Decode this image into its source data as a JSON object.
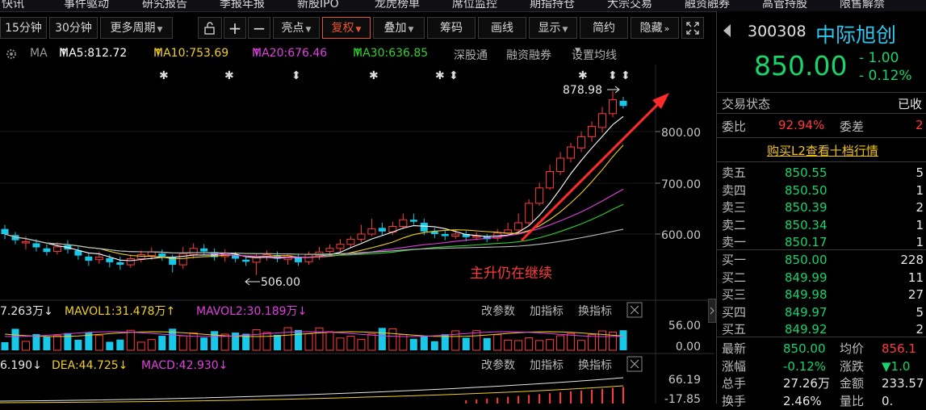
{
  "top_nav": [
    "快讯",
    "事件驱动",
    "研究报告",
    "季报年报",
    "新股IPO",
    "龙虎榜单",
    "席位监控",
    "期指持仓",
    "大宗交易",
    "融资融券",
    "高管持股",
    "限售解禁"
  ],
  "toolbar": {
    "buttons": [
      "15分钟",
      "30分钟",
      "更多周期",
      "",
      "+",
      "−",
      "亮点",
      "复权",
      "叠加",
      "筹码",
      "画线",
      "显示",
      "简约",
      "隐藏"
    ],
    "active": "复权"
  },
  "ma_bar": {
    "label": "MA",
    "ma5": "MA5:812.72",
    "ma10": "MA10:753.69",
    "ma20": "MA20:676.46",
    "ma30": "MA30:636.85",
    "links": [
      "深股通",
      "融资融券",
      "设置均线"
    ]
  },
  "price_axis": [
    "800.00",
    "700.00",
    "600.00"
  ],
  "annotations": {
    "high": "878.98",
    "low": "506.00",
    "comment": "主升仍在继续"
  },
  "volume_bar": {
    "vol": "7.263万",
    "mavol1": "MAVOL1:31.478万",
    "mavol2": "MAVOL2:30.189万",
    "links": [
      "改参数",
      "加指标",
      "换指标"
    ],
    "axis": [
      "56.00",
      "0.00"
    ]
  },
  "macd_bar": {
    "dif": "6.190",
    "dea": "DEA:44.725",
    "macd": "MACD:42.930",
    "links": [
      "改参数",
      "加指标",
      "换指标"
    ],
    "axis": [
      "66.19",
      "-17.85"
    ]
  },
  "quote": {
    "code": "300308",
    "name": "中际旭创",
    "price": "850.00",
    "change": "- 1.00",
    "change_pct": "- 0.12%",
    "status_label": "交易状态",
    "status_value": "已收",
    "weibi_label": "委比",
    "weibi_value": "92.94%",
    "weicha_label": "委差",
    "weicha_value": "2",
    "l2_link": "购买L2查看十档行情",
    "asks": [
      {
        "label": "卖五",
        "price": "850.55",
        "vol": "5"
      },
      {
        "label": "卖四",
        "price": "850.50",
        "vol": "1"
      },
      {
        "label": "卖三",
        "price": "850.39",
        "vol": "2"
      },
      {
        "label": "卖二",
        "price": "850.34",
        "vol": "1"
      },
      {
        "label": "卖一",
        "price": "850.17",
        "vol": "1"
      }
    ],
    "bids": [
      {
        "label": "买一",
        "price": "850.00",
        "vol": "228"
      },
      {
        "label": "买二",
        "price": "849.99",
        "vol": "11"
      },
      {
        "label": "买三",
        "price": "849.98",
        "vol": "27"
      },
      {
        "label": "买四",
        "price": "849.97",
        "vol": "5"
      },
      {
        "label": "买五",
        "price": "849.92",
        "vol": "2"
      }
    ],
    "stats": [
      {
        "l1": "最新",
        "v1": "850.00",
        "l2": "均价",
        "v2": "856.1"
      },
      {
        "l1": "涨幅",
        "v1": "-0.12%",
        "l2": "涨跌",
        "v2": "▼1.0"
      },
      {
        "l1": "总手",
        "v1": "27.26万",
        "l2": "金额",
        "v2": "233.57"
      },
      {
        "l1": "换手",
        "v1": "2.46%",
        "l2": "量比",
        "v2": "0."
      }
    ]
  },
  "colors": {
    "up": "#ff3b3b",
    "down": "#18c8e8",
    "ma5": "#ffffff",
    "ma10": "#f0d020",
    "ma20": "#e040e0",
    "ma30": "#30d030",
    "ma60": "#bbbbbb",
    "accent": "#e8542e"
  },
  "chart_data": {
    "type": "candlestick",
    "y_axis_ticks": [
      600,
      700,
      800
    ],
    "annotated_high": 878.98,
    "annotated_low": 506.0,
    "series": [
      {
        "name": "MA5",
        "last": 812.72
      },
      {
        "name": "MA10",
        "last": 753.69
      },
      {
        "name": "MA20",
        "last": 676.46
      },
      {
        "name": "MA30",
        "last": 636.85
      }
    ],
    "candles": [
      [
        610,
        600,
        618,
        590
      ],
      [
        598,
        588,
        604,
        580
      ],
      [
        585,
        585,
        596,
        570
      ],
      [
        582,
        574,
        590,
        566
      ],
      [
        572,
        565,
        580,
        558
      ],
      [
        566,
        575,
        584,
        560
      ],
      [
        578,
        570,
        588,
        562
      ],
      [
        568,
        558,
        575,
        550
      ],
      [
        556,
        548,
        562,
        538
      ],
      [
        550,
        555,
        566,
        542
      ],
      [
        553,
        545,
        560,
        535
      ],
      [
        545,
        540,
        556,
        530
      ],
      [
        540,
        552,
        560,
        534
      ],
      [
        552,
        560,
        568,
        545
      ],
      [
        558,
        565,
        574,
        550
      ],
      [
        562,
        556,
        570,
        548
      ],
      [
        555,
        540,
        560,
        525
      ],
      [
        540,
        562,
        575,
        532
      ],
      [
        560,
        572,
        582,
        552
      ],
      [
        572,
        566,
        580,
        560
      ],
      [
        565,
        555,
        572,
        548
      ],
      [
        556,
        560,
        570,
        546
      ],
      [
        560,
        552,
        565,
        545
      ],
      [
        550,
        546,
        558,
        538
      ],
      [
        545,
        556,
        562,
        520
      ],
      [
        556,
        560,
        568,
        548
      ],
      [
        558,
        552,
        566,
        545
      ],
      [
        550,
        558,
        562,
        540
      ],
      [
        556,
        545,
        562,
        538
      ],
      [
        546,
        560,
        566,
        540
      ],
      [
        558,
        565,
        575,
        550
      ],
      [
        566,
        572,
        580,
        558
      ],
      [
        572,
        580,
        590,
        565
      ],
      [
        580,
        590,
        596,
        574
      ],
      [
        590,
        600,
        618,
        584
      ],
      [
        600,
        610,
        630,
        596
      ],
      [
        612,
        605,
        622,
        598
      ],
      [
        604,
        615,
        624,
        598
      ],
      [
        615,
        628,
        640,
        610
      ],
      [
        628,
        624,
        640,
        618
      ],
      [
        622,
        605,
        630,
        598
      ],
      [
        605,
        600,
        612,
        592
      ],
      [
        600,
        596,
        608,
        588
      ],
      [
        596,
        600,
        608,
        590
      ],
      [
        600,
        594,
        606,
        586
      ],
      [
        594,
        596,
        604,
        588
      ],
      [
        596,
        590,
        600,
        584
      ],
      [
        592,
        602,
        610,
        586
      ],
      [
        602,
        608,
        622,
        598
      ],
      [
        608,
        622,
        640,
        604
      ],
      [
        622,
        660,
        668,
        618
      ],
      [
        660,
        690,
        700,
        655
      ],
      [
        690,
        722,
        735,
        686
      ],
      [
        722,
        748,
        760,
        715
      ],
      [
        748,
        770,
        778,
        740
      ],
      [
        768,
        790,
        800,
        760
      ],
      [
        790,
        810,
        820,
        780
      ],
      [
        808,
        835,
        848,
        798
      ],
      [
        835,
        862,
        878.98,
        828
      ],
      [
        860,
        850,
        868,
        845
      ]
    ]
  }
}
